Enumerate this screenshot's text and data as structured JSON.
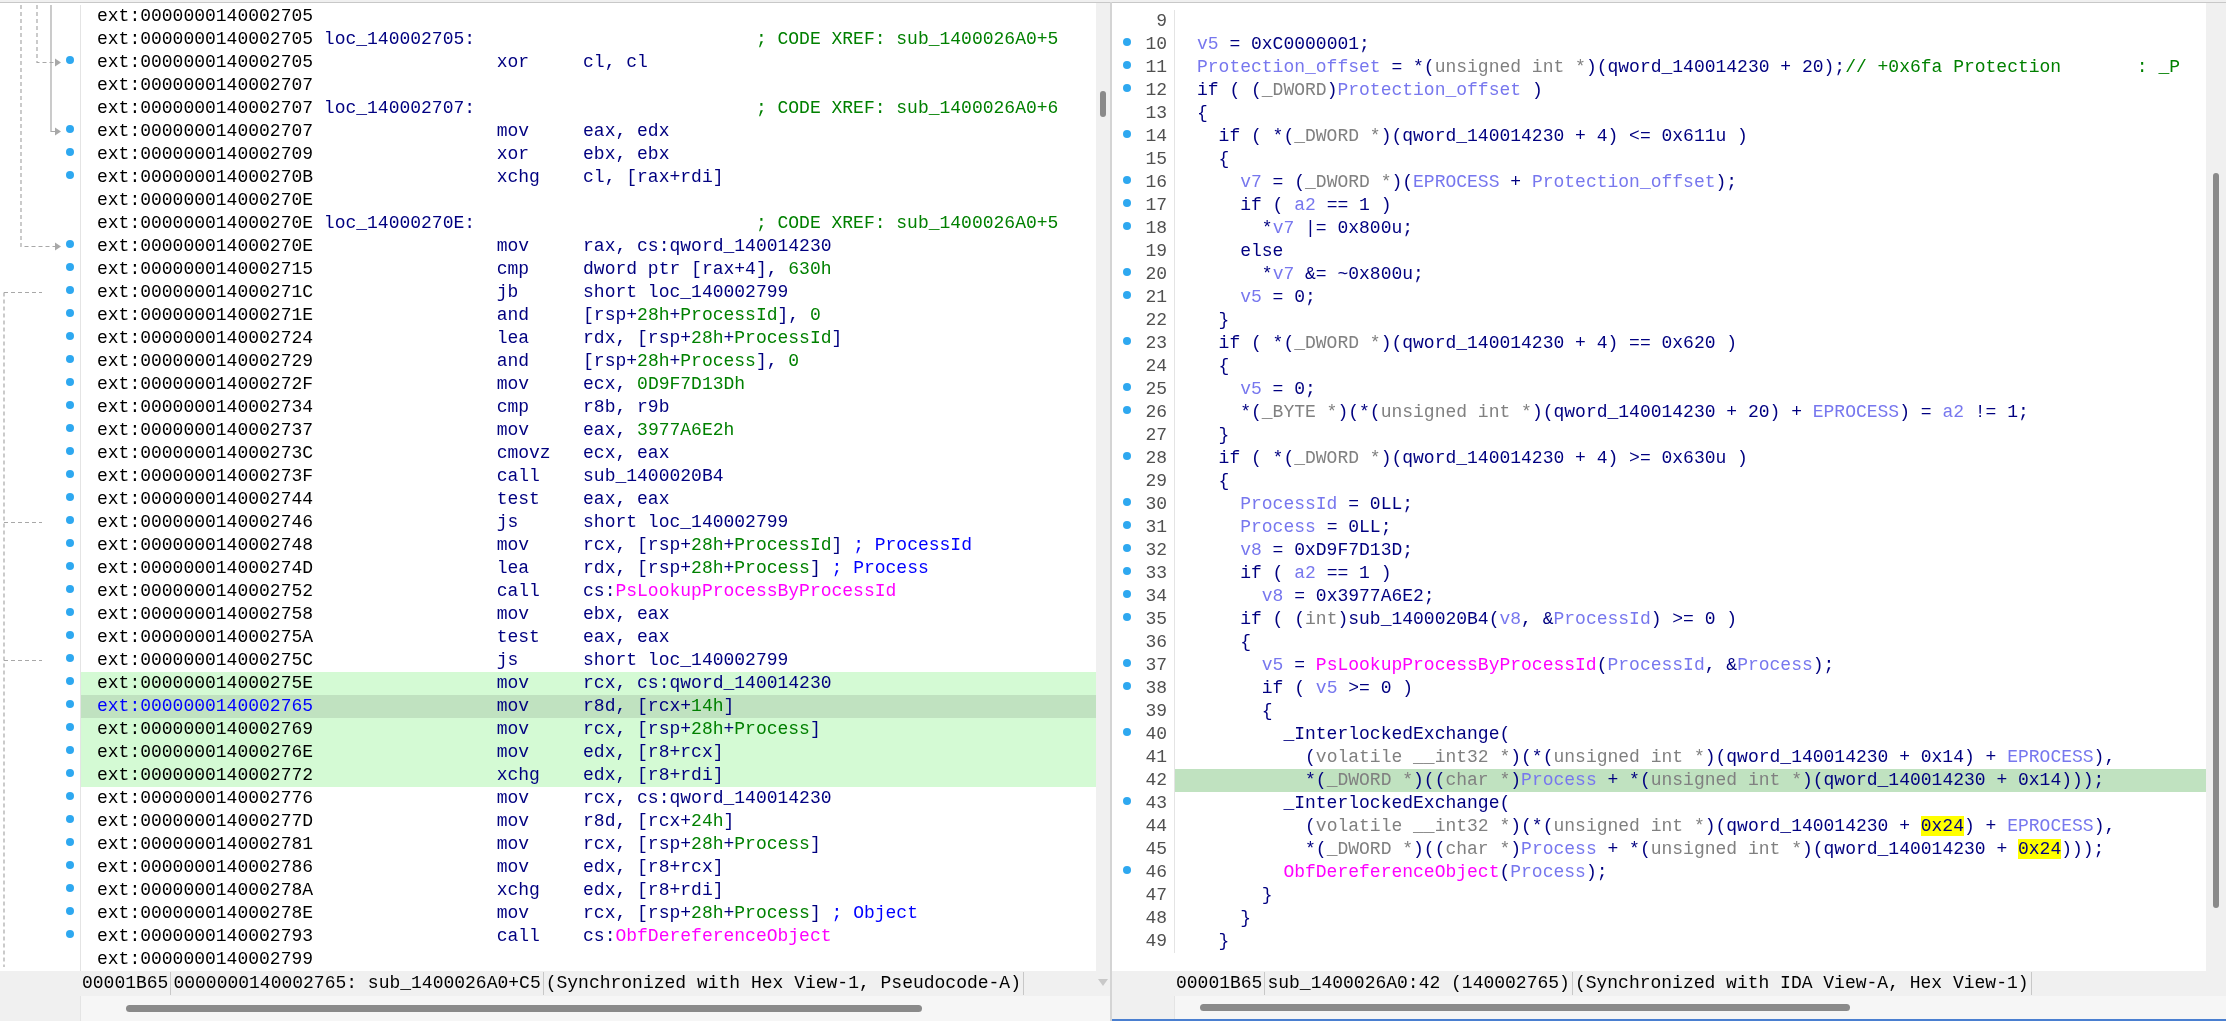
{
  "disassembly": {
    "rows": [
      {
        "address": "ext:0000000140002705",
        "dot": false,
        "synced": false,
        "selected": false
      },
      {
        "address": "ext:0000000140002705",
        "dot": false,
        "synced": false,
        "selected": false,
        "label": "loc_140002705:",
        "xref": "; CODE XREF: sub_1400026A0+5"
      },
      {
        "address": "ext:0000000140002705",
        "dot": true,
        "synced": false,
        "selected": false,
        "mnemonic": "xor",
        "operands": [
          {
            "t": "cl, cl",
            "kind": "plain"
          }
        ]
      },
      {
        "address": "ext:0000000140002707",
        "dot": false,
        "synced": false,
        "selected": false
      },
      {
        "address": "ext:0000000140002707",
        "dot": false,
        "synced": false,
        "selected": false,
        "label": "loc_140002707:",
        "xref": "; CODE XREF: sub_1400026A0+6"
      },
      {
        "address": "ext:0000000140002707",
        "dot": true,
        "synced": false,
        "selected": false,
        "mnemonic": "mov",
        "operands": [
          {
            "t": "eax, edx",
            "kind": "plain"
          }
        ]
      },
      {
        "address": "ext:0000000140002709",
        "dot": true,
        "synced": false,
        "selected": false,
        "mnemonic": "xor",
        "operands": [
          {
            "t": "ebx, ebx",
            "kind": "plain"
          }
        ]
      },
      {
        "address": "ext:000000014000270B",
        "dot": true,
        "synced": false,
        "selected": false,
        "mnemonic": "xchg",
        "operands": [
          {
            "t": "cl, [rax+rdi]",
            "kind": "plain"
          }
        ]
      },
      {
        "address": "ext:000000014000270E",
        "dot": false,
        "synced": false,
        "selected": false
      },
      {
        "address": "ext:000000014000270E",
        "dot": false,
        "synced": false,
        "selected": false,
        "label": "loc_14000270E:",
        "xref": "; CODE XREF: sub_1400026A0+5"
      },
      {
        "address": "ext:000000014000270E",
        "dot": true,
        "synced": false,
        "selected": false,
        "mnemonic": "mov",
        "operands": [
          {
            "t": "rax, cs:qword_140014230",
            "kind": "plain"
          }
        ]
      },
      {
        "address": "ext:0000000140002715",
        "dot": true,
        "synced": false,
        "selected": false,
        "mnemonic": "cmp",
        "operands": [
          {
            "t": "dword ptr [rax+4], ",
            "kind": "plain"
          },
          {
            "t": "630h",
            "kind": "num"
          }
        ]
      },
      {
        "address": "ext:000000014000271C",
        "dot": true,
        "synced": false,
        "selected": false,
        "mnemonic": "jb",
        "operands": [
          {
            "t": "short loc_140002799",
            "kind": "plain"
          }
        ]
      },
      {
        "address": "ext:000000014000271E",
        "dot": true,
        "synced": false,
        "selected": false,
        "mnemonic": "and",
        "operands": [
          {
            "t": "[rsp+",
            "kind": "plain"
          },
          {
            "t": "28h",
            "kind": "num"
          },
          {
            "t": "+",
            "kind": "plain"
          },
          {
            "t": "ProcessId",
            "kind": "num"
          },
          {
            "t": "], ",
            "kind": "plain"
          },
          {
            "t": "0",
            "kind": "num"
          }
        ]
      },
      {
        "address": "ext:0000000140002724",
        "dot": true,
        "synced": false,
        "selected": false,
        "mnemonic": "lea",
        "operands": [
          {
            "t": "rdx, [rsp+",
            "kind": "plain"
          },
          {
            "t": "28h",
            "kind": "num"
          },
          {
            "t": "+",
            "kind": "plain"
          },
          {
            "t": "ProcessId",
            "kind": "num"
          },
          {
            "t": "]",
            "kind": "plain"
          }
        ]
      },
      {
        "address": "ext:0000000140002729",
        "dot": true,
        "synced": false,
        "selected": false,
        "mnemonic": "and",
        "operands": [
          {
            "t": "[rsp+",
            "kind": "plain"
          },
          {
            "t": "28h",
            "kind": "num"
          },
          {
            "t": "+",
            "kind": "plain"
          },
          {
            "t": "Process",
            "kind": "num"
          },
          {
            "t": "], ",
            "kind": "plain"
          },
          {
            "t": "0",
            "kind": "num"
          }
        ]
      },
      {
        "address": "ext:000000014000272F",
        "dot": true,
        "synced": false,
        "selected": false,
        "mnemonic": "mov",
        "operands": [
          {
            "t": "ecx, ",
            "kind": "plain"
          },
          {
            "t": "0D9F7D13Dh",
            "kind": "num"
          }
        ]
      },
      {
        "address": "ext:0000000140002734",
        "dot": true,
        "synced": false,
        "selected": false,
        "mnemonic": "cmp",
        "operands": [
          {
            "t": "r8b, r9b",
            "kind": "plain"
          }
        ]
      },
      {
        "address": "ext:0000000140002737",
        "dot": true,
        "synced": false,
        "selected": false,
        "mnemonic": "mov",
        "operands": [
          {
            "t": "eax, ",
            "kind": "plain"
          },
          {
            "t": "3977A6E2h",
            "kind": "num"
          }
        ]
      },
      {
        "address": "ext:000000014000273C",
        "dot": true,
        "synced": false,
        "selected": false,
        "mnemonic": "cmovz",
        "operands": [
          {
            "t": "ecx, eax",
            "kind": "plain"
          }
        ]
      },
      {
        "address": "ext:000000014000273F",
        "dot": true,
        "synced": false,
        "selected": false,
        "mnemonic": "call",
        "operands": [
          {
            "t": "sub_1400020B4",
            "kind": "plain"
          }
        ]
      },
      {
        "address": "ext:0000000140002744",
        "dot": true,
        "synced": false,
        "selected": false,
        "mnemonic": "test",
        "operands": [
          {
            "t": "eax, eax",
            "kind": "plain"
          }
        ]
      },
      {
        "address": "ext:0000000140002746",
        "dot": true,
        "synced": false,
        "selected": false,
        "mnemonic": "js",
        "operands": [
          {
            "t": "short loc_140002799",
            "kind": "plain"
          }
        ]
      },
      {
        "address": "ext:0000000140002748",
        "dot": true,
        "synced": false,
        "selected": false,
        "mnemonic": "mov",
        "operands": [
          {
            "t": "rcx, [rsp+",
            "kind": "plain"
          },
          {
            "t": "28h",
            "kind": "num"
          },
          {
            "t": "+",
            "kind": "plain"
          },
          {
            "t": "ProcessId",
            "kind": "num"
          },
          {
            "t": "] ",
            "kind": "plain"
          },
          {
            "t": "; ProcessId",
            "kind": "comment"
          }
        ]
      },
      {
        "address": "ext:000000014000274D",
        "dot": true,
        "synced": false,
        "selected": false,
        "mnemonic": "lea",
        "operands": [
          {
            "t": "rdx, [rsp+",
            "kind": "plain"
          },
          {
            "t": "28h",
            "kind": "num"
          },
          {
            "t": "+",
            "kind": "plain"
          },
          {
            "t": "Process",
            "kind": "num"
          },
          {
            "t": "] ",
            "kind": "plain"
          },
          {
            "t": "; Process",
            "kind": "comment"
          }
        ]
      },
      {
        "address": "ext:0000000140002752",
        "dot": true,
        "synced": false,
        "selected": false,
        "mnemonic": "call",
        "operands": [
          {
            "t": "cs:",
            "kind": "plain"
          },
          {
            "t": "PsLookupProcessByProcessId",
            "kind": "import"
          }
        ]
      },
      {
        "address": "ext:0000000140002758",
        "dot": true,
        "synced": false,
        "selected": false,
        "mnemonic": "mov",
        "operands": [
          {
            "t": "ebx, eax",
            "kind": "plain"
          }
        ]
      },
      {
        "address": "ext:000000014000275A",
        "dot": true,
        "synced": false,
        "selected": false,
        "mnemonic": "test",
        "operands": [
          {
            "t": "eax, eax",
            "kind": "plain"
          }
        ]
      },
      {
        "address": "ext:000000014000275C",
        "dot": true,
        "synced": false,
        "selected": false,
        "mnemonic": "js",
        "operands": [
          {
            "t": "short loc_140002799",
            "kind": "plain"
          }
        ]
      },
      {
        "address": "ext:000000014000275E",
        "dot": true,
        "synced": true,
        "selected": false,
        "mnemonic": "mov",
        "operands": [
          {
            "t": "rcx, cs:qword_140014230",
            "kind": "plain"
          }
        ]
      },
      {
        "address": "ext:0000000140002765",
        "dot": true,
        "synced": true,
        "selected": true,
        "mnemonic": "mov",
        "operands": [
          {
            "t": "r8d, [rcx+",
            "kind": "plain"
          },
          {
            "t": "14h",
            "kind": "num"
          },
          {
            "t": "]",
            "kind": "plain"
          }
        ]
      },
      {
        "address": "ext:0000000140002769",
        "dot": true,
        "synced": true,
        "selected": false,
        "mnemonic": "mov",
        "operands": [
          {
            "t": "rcx, [rsp+",
            "kind": "plain"
          },
          {
            "t": "28h",
            "kind": "num"
          },
          {
            "t": "+",
            "kind": "plain"
          },
          {
            "t": "Process",
            "kind": "num"
          },
          {
            "t": "]",
            "kind": "plain"
          }
        ]
      },
      {
        "address": "ext:000000014000276E",
        "dot": true,
        "synced": true,
        "selected": false,
        "mnemonic": "mov",
        "operands": [
          {
            "t": "edx, [r8+rcx]",
            "kind": "plain"
          }
        ]
      },
      {
        "address": "ext:0000000140002772",
        "dot": true,
        "synced": true,
        "selected": false,
        "mnemonic": "xchg",
        "operands": [
          {
            "t": "edx, [r8+rdi]",
            "kind": "plain"
          }
        ]
      },
      {
        "address": "ext:0000000140002776",
        "dot": true,
        "synced": false,
        "selected": false,
        "mnemonic": "mov",
        "operands": [
          {
            "t": "rcx, cs:qword_140014230",
            "kind": "plain"
          }
        ]
      },
      {
        "address": "ext:000000014000277D",
        "dot": true,
        "synced": false,
        "selected": false,
        "mnemonic": "mov",
        "operands": [
          {
            "t": "r8d, [rcx+",
            "kind": "plain"
          },
          {
            "t": "24h",
            "kind": "num"
          },
          {
            "t": "]",
            "kind": "plain"
          }
        ]
      },
      {
        "address": "ext:0000000140002781",
        "dot": true,
        "synced": false,
        "selected": false,
        "mnemonic": "mov",
        "operands": [
          {
            "t": "rcx, [rsp+",
            "kind": "plain"
          },
          {
            "t": "28h",
            "kind": "num"
          },
          {
            "t": "+",
            "kind": "plain"
          },
          {
            "t": "Process",
            "kind": "num"
          },
          {
            "t": "]",
            "kind": "plain"
          }
        ]
      },
      {
        "address": "ext:0000000140002786",
        "dot": true,
        "synced": false,
        "selected": false,
        "mnemonic": "mov",
        "operands": [
          {
            "t": "edx, [r8+rcx]",
            "kind": "plain"
          }
        ]
      },
      {
        "address": "ext:000000014000278A",
        "dot": true,
        "synced": false,
        "selected": false,
        "mnemonic": "xchg",
        "operands": [
          {
            "t": "edx, [r8+rdi]",
            "kind": "plain"
          }
        ]
      },
      {
        "address": "ext:000000014000278E",
        "dot": true,
        "synced": false,
        "selected": false,
        "mnemonic": "mov",
        "operands": [
          {
            "t": "rcx, [rsp+",
            "kind": "plain"
          },
          {
            "t": "28h",
            "kind": "num"
          },
          {
            "t": "+",
            "kind": "plain"
          },
          {
            "t": "Process",
            "kind": "num"
          },
          {
            "t": "] ",
            "kind": "plain"
          },
          {
            "t": "; Object",
            "kind": "comment"
          }
        ]
      },
      {
        "address": "ext:0000000140002793",
        "dot": true,
        "synced": false,
        "selected": false,
        "mnemonic": "call",
        "operands": [
          {
            "t": "cs:",
            "kind": "plain"
          },
          {
            "t": "ObfDereferenceObject",
            "kind": "import"
          }
        ]
      },
      {
        "address": "ext:0000000140002799",
        "dot": false,
        "synced": false,
        "selected": false
      }
    ],
    "status_bar": [
      "00001B65",
      "0000000140002765: sub_1400026A0+C5",
      "(Synchronized with Hex View-1, Pseudocode-A)"
    ]
  },
  "pseudocode": {
    "lines": [
      {
        "number": "9",
        "dot": false,
        "selected": false
      },
      {
        "number": "10",
        "dot": true,
        "selected": false,
        "code": [
          {
            "t": "v5",
            "kind": "local"
          },
          {
            "t": " = 0xC0000001;",
            "kind": "plain"
          }
        ]
      },
      {
        "number": "11",
        "dot": true,
        "selected": false,
        "code": [
          {
            "t": "Protection_offset",
            "kind": "local"
          },
          {
            "t": " = *(",
            "kind": "plain"
          },
          {
            "t": "unsigned int *",
            "kind": "type"
          },
          {
            "t": ")(qword_140014230 + 20);",
            "kind": "plain"
          },
          {
            "t": "// +0x6fa Protection       : _P",
            "kind": "comment"
          }
        ]
      },
      {
        "number": "12",
        "dot": true,
        "selected": false,
        "code": [
          {
            "t": "if ( (",
            "kind": "plain"
          },
          {
            "t": "_DWORD",
            "kind": "type"
          },
          {
            "t": ")",
            "kind": "plain"
          },
          {
            "t": "Protection_offset",
            "kind": "local"
          },
          {
            "t": " )",
            "kind": "plain"
          }
        ]
      },
      {
        "number": "13",
        "dot": false,
        "selected": false,
        "code": [
          {
            "t": "{",
            "kind": "plain"
          }
        ]
      },
      {
        "number": "14",
        "dot": true,
        "selected": false,
        "code": [
          {
            "t": "  if ( *(",
            "kind": "plain"
          },
          {
            "t": "_DWORD *",
            "kind": "type"
          },
          {
            "t": ")(qword_140014230 + 4) <= 0x611u )",
            "kind": "plain"
          }
        ]
      },
      {
        "number": "15",
        "dot": false,
        "selected": false,
        "code": [
          {
            "t": "  {",
            "kind": "plain"
          }
        ]
      },
      {
        "number": "16",
        "dot": true,
        "selected": false,
        "code": [
          {
            "t": "    v7",
            "kind": "local"
          },
          {
            "t": " = (",
            "kind": "plain"
          },
          {
            "t": "_DWORD *",
            "kind": "type"
          },
          {
            "t": ")(",
            "kind": "plain"
          },
          {
            "t": "EPROCESS",
            "kind": "local"
          },
          {
            "t": " + ",
            "kind": "plain"
          },
          {
            "t": "Protection_offset",
            "kind": "local"
          },
          {
            "t": ");",
            "kind": "plain"
          }
        ]
      },
      {
        "number": "17",
        "dot": true,
        "selected": false,
        "code": [
          {
            "t": "    if ( ",
            "kind": "plain"
          },
          {
            "t": "a2",
            "kind": "local"
          },
          {
            "t": " == 1 )",
            "kind": "plain"
          }
        ]
      },
      {
        "number": "18",
        "dot": true,
        "selected": false,
        "code": [
          {
            "t": "      *",
            "kind": "plain"
          },
          {
            "t": "v7",
            "kind": "local"
          },
          {
            "t": " |= 0x800u;",
            "kind": "plain"
          }
        ]
      },
      {
        "number": "19",
        "dot": false,
        "selected": false,
        "code": [
          {
            "t": "    else",
            "kind": "plain"
          }
        ]
      },
      {
        "number": "20",
        "dot": true,
        "selected": false,
        "code": [
          {
            "t": "      *",
            "kind": "plain"
          },
          {
            "t": "v7",
            "kind": "local"
          },
          {
            "t": " &= ~0x800u;",
            "kind": "plain"
          }
        ]
      },
      {
        "number": "21",
        "dot": true,
        "selected": false,
        "code": [
          {
            "t": "    v5",
            "kind": "local"
          },
          {
            "t": " = 0;",
            "kind": "plain"
          }
        ]
      },
      {
        "number": "22",
        "dot": false,
        "selected": false,
        "code": [
          {
            "t": "  }",
            "kind": "plain"
          }
        ]
      },
      {
        "number": "23",
        "dot": true,
        "selected": false,
        "code": [
          {
            "t": "  if ( *(",
            "kind": "plain"
          },
          {
            "t": "_DWORD *",
            "kind": "type"
          },
          {
            "t": ")(qword_140014230 + 4) == 0x620 )",
            "kind": "plain"
          }
        ]
      },
      {
        "number": "24",
        "dot": false,
        "selected": false,
        "code": [
          {
            "t": "  {",
            "kind": "plain"
          }
        ]
      },
      {
        "number": "25",
        "dot": true,
        "selected": false,
        "code": [
          {
            "t": "    v5",
            "kind": "local"
          },
          {
            "t": " = 0;",
            "kind": "plain"
          }
        ]
      },
      {
        "number": "26",
        "dot": true,
        "selected": false,
        "code": [
          {
            "t": "    *(",
            "kind": "plain"
          },
          {
            "t": "_BYTE *",
            "kind": "type"
          },
          {
            "t": ")(*(",
            "kind": "plain"
          },
          {
            "t": "unsigned int *",
            "kind": "type"
          },
          {
            "t": ")(qword_140014230 + 20) + ",
            "kind": "plain"
          },
          {
            "t": "EPROCESS",
            "kind": "local"
          },
          {
            "t": ") = ",
            "kind": "plain"
          },
          {
            "t": "a2",
            "kind": "local"
          },
          {
            "t": " != 1;",
            "kind": "plain"
          }
        ]
      },
      {
        "number": "27",
        "dot": false,
        "selected": false,
        "code": [
          {
            "t": "  }",
            "kind": "plain"
          }
        ]
      },
      {
        "number": "28",
        "dot": true,
        "selected": false,
        "code": [
          {
            "t": "  if ( *(",
            "kind": "plain"
          },
          {
            "t": "_DWORD *",
            "kind": "type"
          },
          {
            "t": ")(qword_140014230 + 4) >= 0x630u )",
            "kind": "plain"
          }
        ]
      },
      {
        "number": "29",
        "dot": false,
        "selected": false,
        "code": [
          {
            "t": "  {",
            "kind": "plain"
          }
        ]
      },
      {
        "number": "30",
        "dot": true,
        "selected": false,
        "code": [
          {
            "t": "    ProcessId",
            "kind": "local"
          },
          {
            "t": " = 0LL;",
            "kind": "plain"
          }
        ]
      },
      {
        "number": "31",
        "dot": true,
        "selected": false,
        "code": [
          {
            "t": "    Process",
            "kind": "local"
          },
          {
            "t": " = 0LL;",
            "kind": "plain"
          }
        ]
      },
      {
        "number": "32",
        "dot": true,
        "selected": false,
        "code": [
          {
            "t": "    v8",
            "kind": "local"
          },
          {
            "t": " = 0xD9F7D13D;",
            "kind": "plain"
          }
        ]
      },
      {
        "number": "33",
        "dot": true,
        "selected": false,
        "code": [
          {
            "t": "    if ( ",
            "kind": "plain"
          },
          {
            "t": "a2",
            "kind": "local"
          },
          {
            "t": " == 1 )",
            "kind": "plain"
          }
        ]
      },
      {
        "number": "34",
        "dot": true,
        "selected": false,
        "code": [
          {
            "t": "      v8",
            "kind": "local"
          },
          {
            "t": " = 0x3977A6E2;",
            "kind": "plain"
          }
        ]
      },
      {
        "number": "35",
        "dot": true,
        "selected": false,
        "code": [
          {
            "t": "    if ( (",
            "kind": "plain"
          },
          {
            "t": "int",
            "kind": "type"
          },
          {
            "t": ")sub_1400020B4(",
            "kind": "plain"
          },
          {
            "t": "v8",
            "kind": "local"
          },
          {
            "t": ", &",
            "kind": "plain"
          },
          {
            "t": "ProcessId",
            "kind": "local"
          },
          {
            "t": ") >= 0 )",
            "kind": "plain"
          }
        ]
      },
      {
        "number": "36",
        "dot": false,
        "selected": false,
        "code": [
          {
            "t": "    {",
            "kind": "plain"
          }
        ]
      },
      {
        "number": "37",
        "dot": true,
        "selected": false,
        "code": [
          {
            "t": "      v5",
            "kind": "local"
          },
          {
            "t": " = ",
            "kind": "plain"
          },
          {
            "t": "PsLookupProcessByProcessId",
            "kind": "import"
          },
          {
            "t": "(",
            "kind": "plain"
          },
          {
            "t": "ProcessId",
            "kind": "local"
          },
          {
            "t": ", &",
            "kind": "plain"
          },
          {
            "t": "Process",
            "kind": "local"
          },
          {
            "t": ");",
            "kind": "plain"
          }
        ]
      },
      {
        "number": "38",
        "dot": true,
        "selected": false,
        "code": [
          {
            "t": "      if ( ",
            "kind": "plain"
          },
          {
            "t": "v5",
            "kind": "local"
          },
          {
            "t": " >= 0 )",
            "kind": "plain"
          }
        ]
      },
      {
        "number": "39",
        "dot": false,
        "selected": false,
        "code": [
          {
            "t": "      {",
            "kind": "plain"
          }
        ]
      },
      {
        "number": "40",
        "dot": true,
        "selected": false,
        "code": [
          {
            "t": "        _InterlockedExchange(",
            "kind": "plain"
          }
        ]
      },
      {
        "number": "41",
        "dot": false,
        "selected": false,
        "code": [
          {
            "t": "          (",
            "kind": "plain"
          },
          {
            "t": "volatile __int32 *",
            "kind": "type"
          },
          {
            "t": ")(*(",
            "kind": "plain"
          },
          {
            "t": "unsigned int *",
            "kind": "type"
          },
          {
            "t": ")(qword_140014230 + 0x14) + ",
            "kind": "plain"
          },
          {
            "t": "EPROCESS",
            "kind": "local"
          },
          {
            "t": "),",
            "kind": "plain"
          }
        ]
      },
      {
        "number": "42",
        "dot": false,
        "selected": true,
        "code": [
          {
            "t": "          *(",
            "kind": "plain"
          },
          {
            "t": "_DWORD *",
            "kind": "type"
          },
          {
            "t": ")((",
            "kind": "plain"
          },
          {
            "t": "char *",
            "kind": "type"
          },
          {
            "t": ")",
            "kind": "plain"
          },
          {
            "t": "Process",
            "kind": "local"
          },
          {
            "t": " + *(",
            "kind": "plain"
          },
          {
            "t": "unsigned int *",
            "kind": "type"
          },
          {
            "t": ")(qword_140014230 + 0x14)));",
            "kind": "plain"
          }
        ]
      },
      {
        "number": "43",
        "dot": true,
        "selected": false,
        "code": [
          {
            "t": "        _InterlockedExchange(",
            "kind": "plain"
          }
        ]
      },
      {
        "number": "44",
        "dot": false,
        "selected": false,
        "code": [
          {
            "t": "          (",
            "kind": "plain"
          },
          {
            "t": "volatile __int32 *",
            "kind": "type"
          },
          {
            "t": ")(*(",
            "kind": "plain"
          },
          {
            "t": "unsigned int *",
            "kind": "type"
          },
          {
            "t": ")(qword_140014230 + ",
            "kind": "plain"
          },
          {
            "t": "0x24",
            "kind": "match"
          },
          {
            "t": ") + ",
            "kind": "plain"
          },
          {
            "t": "EPROCESS",
            "kind": "local"
          },
          {
            "t": "),",
            "kind": "plain"
          }
        ]
      },
      {
        "number": "45",
        "dot": false,
        "selected": false,
        "code": [
          {
            "t": "          *(",
            "kind": "plain"
          },
          {
            "t": "_DWORD *",
            "kind": "type"
          },
          {
            "t": ")((",
            "kind": "plain"
          },
          {
            "t": "char *",
            "kind": "type"
          },
          {
            "t": ")",
            "kind": "plain"
          },
          {
            "t": "Process",
            "kind": "local"
          },
          {
            "t": " + *(",
            "kind": "plain"
          },
          {
            "t": "unsigned int *",
            "kind": "type"
          },
          {
            "t": ")(qword_140014230 + ",
            "kind": "plain"
          },
          {
            "t": "0x24",
            "kind": "match"
          },
          {
            "t": ")));",
            "kind": "plain"
          }
        ]
      },
      {
        "number": "46",
        "dot": true,
        "selected": false,
        "code": [
          {
            "t": "        ObfDereferenceObject",
            "kind": "import"
          },
          {
            "t": "(",
            "kind": "plain"
          },
          {
            "t": "Process",
            "kind": "local"
          },
          {
            "t": ");",
            "kind": "plain"
          }
        ]
      },
      {
        "number": "47",
        "dot": false,
        "selected": false,
        "code": [
          {
            "t": "      }",
            "kind": "plain"
          }
        ]
      },
      {
        "number": "48",
        "dot": false,
        "selected": false,
        "code": [
          {
            "t": "    }",
            "kind": "plain"
          }
        ]
      },
      {
        "number": "49",
        "dot": false,
        "selected": false,
        "code": [
          {
            "t": "  }",
            "kind": "plain"
          }
        ]
      }
    ],
    "status_bar": [
      "00001B65",
      "sub_1400026A0:42 (140002765)",
      "(Synchronized with IDA View-A, Hex View-1)"
    ]
  }
}
